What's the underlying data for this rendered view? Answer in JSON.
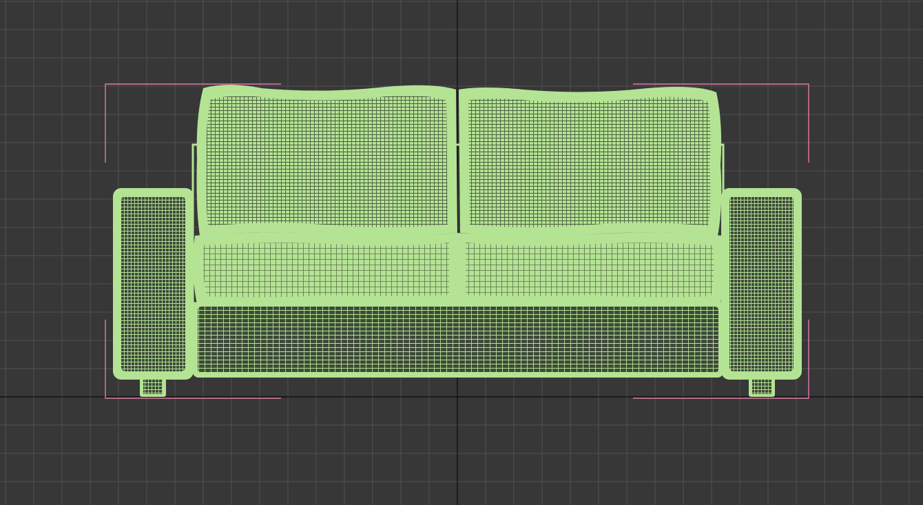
{
  "viewport": {
    "view": "front",
    "shading": "wireframe",
    "background_color": "#373737",
    "grid_color": "#525252",
    "grid_visible": true,
    "world_axis_color": "#0a0a0a",
    "selection_bracket_color": "#e07aa8"
  },
  "model": {
    "object": "sofa",
    "selected": true,
    "wire_color": "#b4e394",
    "wire_dark": "#3a4a33",
    "parts": [
      "left-armrest",
      "right-armrest",
      "back-cushion-left",
      "back-cushion-right",
      "seat-cushion-left",
      "seat-cushion-right",
      "base-frame",
      "back-frame",
      "leg-left",
      "leg-right"
    ]
  }
}
